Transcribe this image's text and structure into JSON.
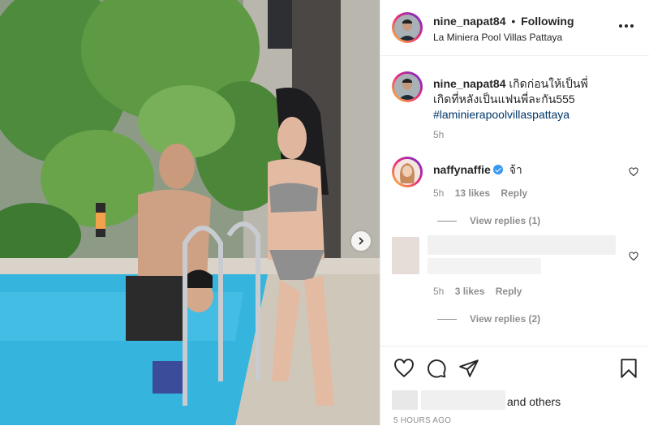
{
  "post": {
    "author": "nine_napat84",
    "follow_status": "Following",
    "separator": "•",
    "location": "La Miniera Pool Villas Pattaya",
    "caption_line1": "เกิดก่อนให้เป็นพี่",
    "caption_line2": "เกิดที่หลังเป็นแฟนพี่ละกัน555",
    "hashtag": "#laminierapoolvillaspattaya",
    "caption_time": "5h",
    "likes_suffix": "and others",
    "posted_ago": "5 HOURS AGO"
  },
  "comments": [
    {
      "username": "naffynaffie",
      "verified": true,
      "text": "จ้า",
      "time": "5h",
      "likes": "13 likes",
      "reply": "Reply",
      "view_replies": "View replies (1)"
    },
    {
      "username": "",
      "text": "",
      "time": "5h",
      "likes": "3 likes",
      "reply": "Reply",
      "view_replies": "View replies (2)"
    }
  ],
  "icons": {
    "more": "more-options-icon",
    "like": "heart-icon",
    "comment": "comment-icon",
    "share": "paper-plane-icon",
    "save": "bookmark-icon",
    "next": "chevron-right-icon"
  },
  "colors": {
    "text": "#262626",
    "muted": "#8e8e8e",
    "link": "#00376b",
    "verified": "#3897f0",
    "pool": "#35b4dd"
  }
}
